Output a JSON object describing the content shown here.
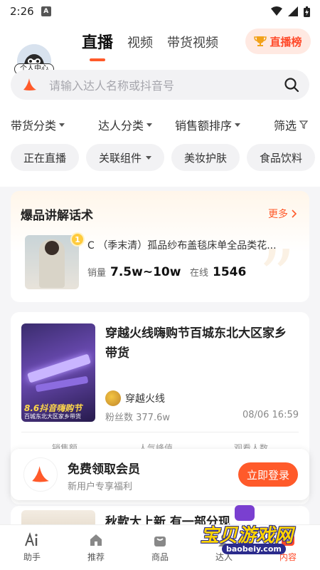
{
  "status_bar": {
    "time": "2:26",
    "app_badge": "A"
  },
  "header": {
    "avatar_label": "个人中心",
    "tabs": [
      {
        "label": "直播",
        "active": true
      },
      {
        "label": "视频",
        "active": false
      },
      {
        "label": "带货视频",
        "active": false
      }
    ],
    "rank_button": "直播榜"
  },
  "search": {
    "placeholder": "请输入达人名称或抖音号"
  },
  "filters": [
    {
      "label": "带货分类"
    },
    {
      "label": "达人分类"
    },
    {
      "label": "销售额排序"
    },
    {
      "label": "筛选"
    }
  ],
  "chips": [
    {
      "label": "正在直播"
    },
    {
      "label": "关联组件"
    },
    {
      "label": "美妆护肤"
    },
    {
      "label": "食品饮料"
    }
  ],
  "hot_card": {
    "title": "爆品讲解话术",
    "more": "更多",
    "rank": "1",
    "product": "C （季末清）孤品纱布盖毯床单全品类花...",
    "sales_label": "销量",
    "sales_value": "7.5w~10w",
    "online_label": "在线",
    "online_value": "1546"
  },
  "live_card": {
    "title": "穿越火线嗨购节百城东北大区家乡带货",
    "thumb_promo": "8.6抖音嗨购节",
    "thumb_sub": "百城东北大区家乡带货",
    "anchor_name": "穿越火线",
    "fans": "粉丝数 377.6w",
    "time": "08/06 16:59",
    "stat_labels": [
      "销售额",
      "人气峰值",
      "观看人数"
    ]
  },
  "promo": {
    "title": "免费领取会员",
    "subtitle": "新用户专享福利",
    "button": "立即登录"
  },
  "next_card": {
    "title": "秋款大上新 有一部分现"
  },
  "bottom_nav": [
    {
      "label": "助手",
      "icon": "ai-icon",
      "active": false
    },
    {
      "label": "推荐",
      "icon": "home-icon",
      "active": false
    },
    {
      "label": "商品",
      "icon": "bag-icon",
      "active": false
    },
    {
      "label": "达人",
      "icon": "person-icon",
      "active": false
    },
    {
      "label": "内容",
      "icon": "play-icon",
      "active": true
    }
  ],
  "watermark": {
    "text": "宝贝游戏网",
    "url": "baobeiy.com"
  },
  "colors": {
    "accent": "#ff5a2a",
    "rank_bg": "#ffe9e2"
  }
}
